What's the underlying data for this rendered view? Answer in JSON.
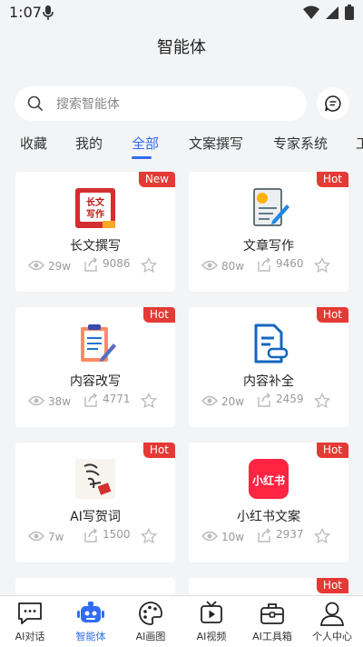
{
  "status": {
    "time": "1:07"
  },
  "header": {
    "title": "智能体"
  },
  "search": {
    "placeholder": "搜索智能体"
  },
  "tabs": [
    "收藏",
    "我的",
    "全部",
    "文案撰写",
    "专家系统",
    "工"
  ],
  "cards": [
    {
      "name": "长文撰写",
      "badge": "New",
      "views": "29w",
      "shares": "9086",
      "icon": "long-article-icon"
    },
    {
      "name": "文章写作",
      "badge": "Hot",
      "views": "80w",
      "shares": "9460",
      "icon": "article-writing-icon"
    },
    {
      "name": "内容改写",
      "badge": "Hot",
      "views": "38w",
      "shares": "4771",
      "icon": "content-rewrite-icon"
    },
    {
      "name": "内容补全",
      "badge": "Hot",
      "views": "20w",
      "shares": "2459",
      "icon": "content-complete-icon"
    },
    {
      "name": "AI写贺词",
      "badge": "Hot",
      "views": "7w",
      "shares": "1500",
      "icon": "greeting-icon"
    },
    {
      "name": "小红书文案",
      "badge": "Hot",
      "views": "10w",
      "shares": "2937",
      "icon": "xiaohongshu-icon"
    },
    {
      "name": "",
      "badge": "",
      "views": "",
      "shares": "",
      "icon": "partial-card-icon"
    },
    {
      "name": "",
      "badge": "Hot",
      "views": "",
      "shares": "",
      "icon": "partial-card-icon"
    }
  ],
  "xhs_logo_text": "小红书",
  "long_icon_text": [
    "长文",
    "写作"
  ],
  "nav": [
    {
      "label": "AI对话",
      "icon": "chat-icon"
    },
    {
      "label": "智能体",
      "icon": "robot-icon"
    },
    {
      "label": "AI画图",
      "icon": "palette-icon"
    },
    {
      "label": "AI视频",
      "icon": "video-icon"
    },
    {
      "label": "AI工具箱",
      "icon": "toolbox-icon"
    },
    {
      "label": "个人中心",
      "icon": "profile-icon"
    }
  ],
  "colors": {
    "accent": "#2f6df6",
    "badge": "#e53935",
    "background": "#f3f4f6"
  }
}
